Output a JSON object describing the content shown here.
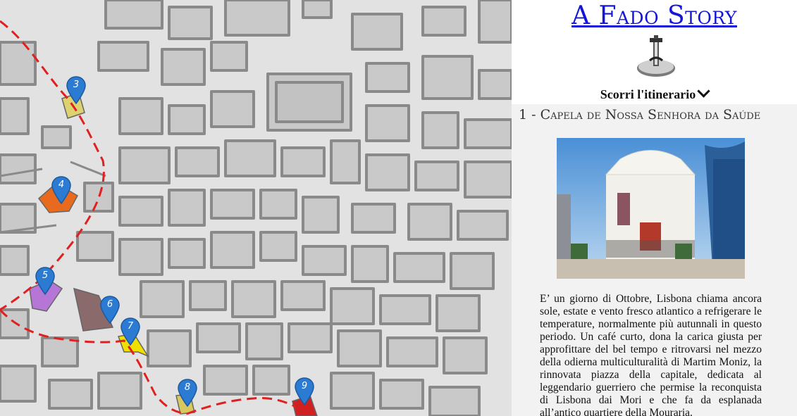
{
  "app": {
    "title": "A Fado Story",
    "scroll_label": "Scorri l'itinerario"
  },
  "map": {
    "route_color": "#e02020",
    "markers": [
      {
        "label": "3",
        "highlight_color": "#dcd270"
      },
      {
        "label": "4",
        "highlight_color": "#e86a1e"
      },
      {
        "label": "5",
        "highlight_color": "#b576d6"
      },
      {
        "label": "6",
        "highlight_color": "#8a6a6a"
      },
      {
        "label": "7",
        "highlight_color": "#f0e000"
      },
      {
        "label": "8",
        "highlight_color": "#d8c860"
      },
      {
        "label": "9",
        "highlight_color": "#d02020"
      }
    ]
  },
  "stop": {
    "title": "1 - Capela de Nossa Senhora da Saúde",
    "text": "E’ un giorno di Ottobre, Lisbona chiama ancora sole, estate e vento fresco atlantico a refrigerare le temperature, normalmente più autunnali in questo periodo. Un café curto, dona la carica giusta per approfittare del bel tempo e ritrovarsi nel mezzo della odierna multiculturalità di Martim Moniz, la rinnovata piazza della capitale, dedicata al leggendario guerriero che permise la reconquista di Lisbona dai Mori e che fa da esplanada all’antico quartiere della Mouraria."
  }
}
